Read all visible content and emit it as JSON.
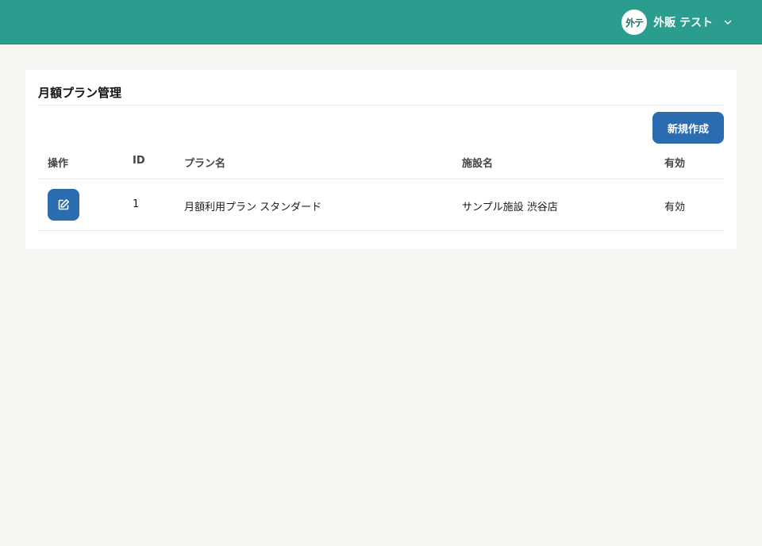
{
  "header": {
    "avatar_initials": "外テ",
    "user_name": "外販 テスト",
    "icons": {
      "dropdown": "chevron-down-icon"
    }
  },
  "colors": {
    "header_bg": "#2a9d8f",
    "primary_button": "#2b6cb0",
    "page_bg": "#f6f5f2"
  },
  "card": {
    "title": "月額プラン管理",
    "new_button_label": "新規作成"
  },
  "table": {
    "columns": [
      "操作",
      "ID",
      "プラン名",
      "施設名",
      "有効"
    ],
    "rows": [
      {
        "action_icon": "edit-icon",
        "id": "1",
        "plan_name": "月額利用プラン スタンダード",
        "facility": "サンプル施設 渋谷店",
        "active": "有効"
      }
    ]
  }
}
